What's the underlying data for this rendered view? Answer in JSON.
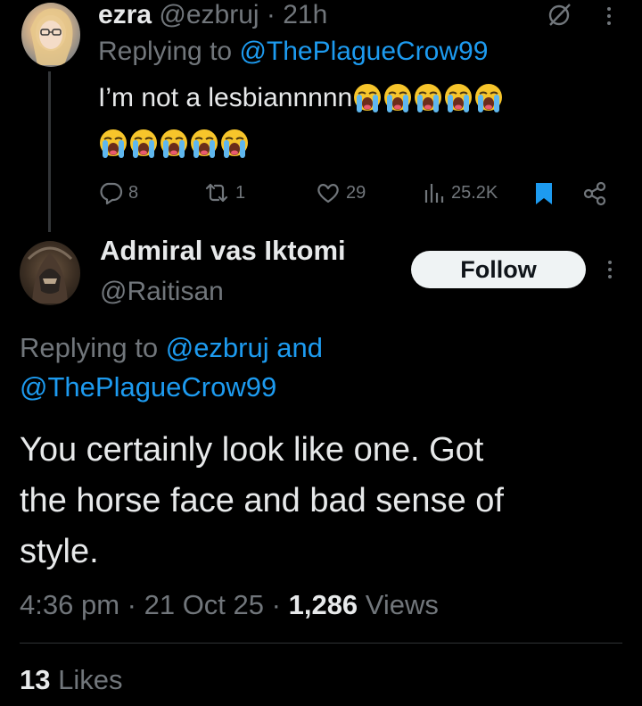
{
  "tweet1": {
    "name": "ezra",
    "handle": "@ezbruj",
    "sep": "·",
    "time": "21h",
    "replying_prefix": "Replying to",
    "replying_handle": "@ThePlagueCrow99",
    "text": "I’m not a lesbiannnnn",
    "emoji_line1_count": 5,
    "emoji_line2_count": 5,
    "stats": {
      "replies": "8",
      "reposts": "1",
      "likes": "29",
      "views": "25.2K"
    }
  },
  "tweet2": {
    "name": "Admiral vas Iktomi",
    "handle": "@Raitisan",
    "follow_label": "Follow",
    "replying_prefix": "Replying to",
    "replying_handle1": "@ezbruj",
    "replying_and": "and",
    "replying_handle2": "@ThePlagueCrow99",
    "text_line1": "You certainly look like one. Got",
    "text_line2": "the horse face and bad sense of",
    "text_line3": "style.",
    "time": "4:36 pm",
    "sep1": "·",
    "date": "21 Oct 25",
    "sep2": "·",
    "views_count": "1,286",
    "views_label": "Views",
    "likes_count": "13",
    "likes_label": "Likes"
  },
  "colors": {
    "background": "#000000",
    "text": "#e7e9ea",
    "muted": "#71767b",
    "link": "#1d9bf0",
    "bookmark": "#1d9bf0"
  }
}
